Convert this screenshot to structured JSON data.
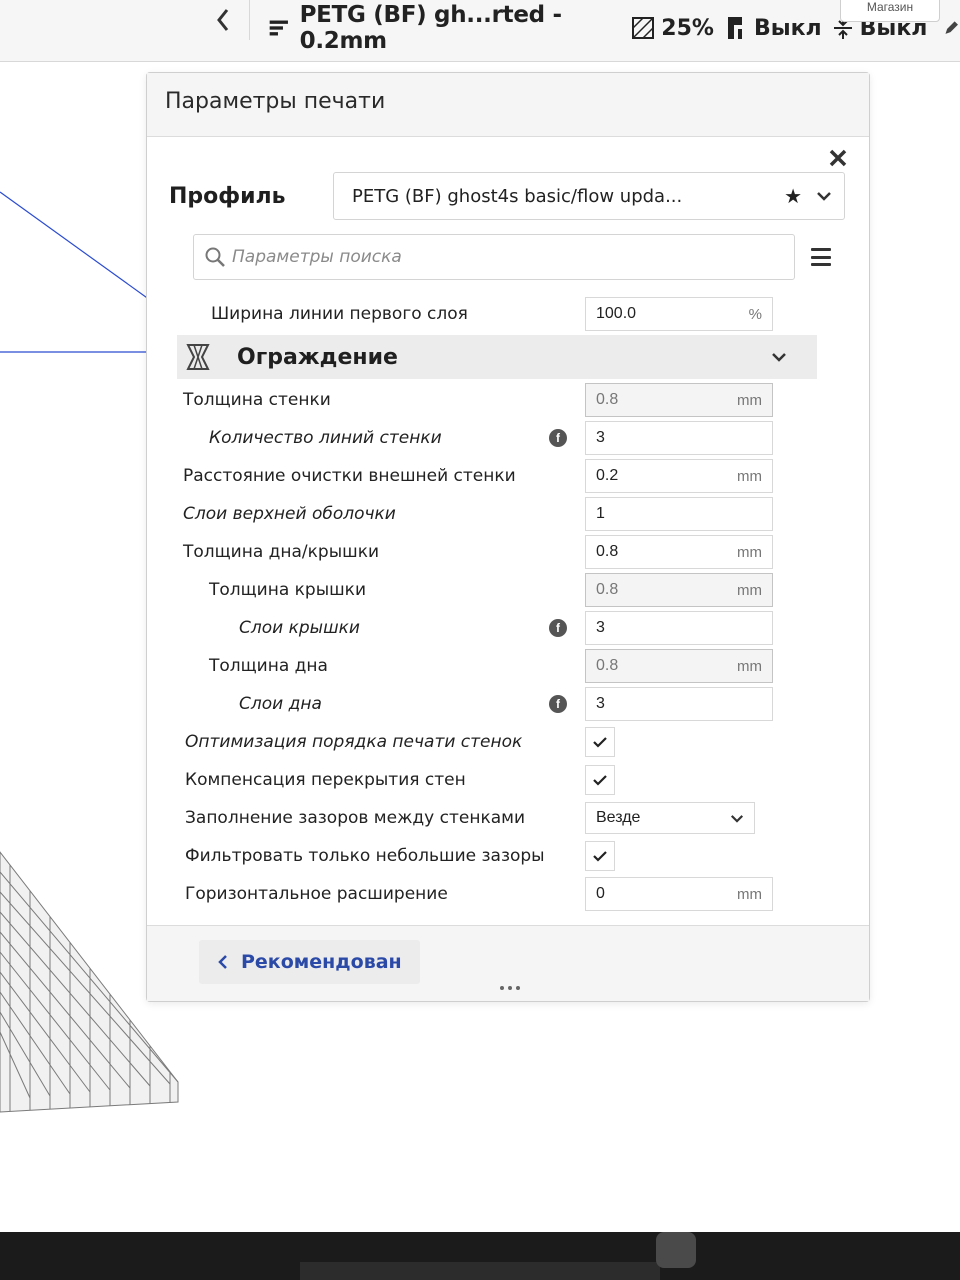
{
  "topbar": {
    "profile_summary": "PETG (BF) gh...rted - 0.2mm",
    "infill": "25%",
    "support": "Выкл",
    "adhesion": "Выкл",
    "shop_label": "Магазин"
  },
  "panel": {
    "title": "Параметры печати",
    "profile_label": "Профиль",
    "profile_value": "PETG (BF) ghost4s basic/flow upda...",
    "search_placeholder": "Параметры поиска",
    "footer_button": "Рекомендован"
  },
  "settings": {
    "first_layer_width": {
      "label": "Ширина линии первого слоя",
      "value": "100.0",
      "unit": "%"
    },
    "section": {
      "title": "Ограждение"
    },
    "wall_thickness": {
      "label": "Толщина стенки",
      "value": "0.8",
      "unit": "mm"
    },
    "wall_line_count": {
      "label": "Количество линий стенки",
      "value": "3"
    },
    "outer_wall_wipe": {
      "label": "Расстояние очистки внешней стенки",
      "value": "0.2",
      "unit": "mm"
    },
    "top_surface_layers": {
      "label": "Слои верхней оболочки",
      "value": "1"
    },
    "top_bottom_thickness": {
      "label": "Толщина дна/крышки",
      "value": "0.8",
      "unit": "mm"
    },
    "top_thickness": {
      "label": "Толщина крышки",
      "value": "0.8",
      "unit": "mm"
    },
    "top_layers": {
      "label": "Слои крышки",
      "value": "3"
    },
    "bottom_thickness": {
      "label": "Толщина дна",
      "value": "0.8",
      "unit": "mm"
    },
    "bottom_layers": {
      "label": "Слои дна",
      "value": "3"
    },
    "optimize_wall_order": {
      "label": "Оптимизация порядка печати стенок",
      "checked": true
    },
    "wall_overlap_comp": {
      "label": "Компенсация перекрытия стен",
      "checked": true
    },
    "fill_gaps": {
      "label": "Заполнение зазоров между стенками",
      "value": "Везде"
    },
    "filter_small_gaps": {
      "label": "Фильтровать только небольшие зазоры",
      "checked": true
    },
    "horizontal_expansion": {
      "label": "Горизонтальное расширение",
      "value": "0",
      "unit": "mm"
    }
  },
  "colors": {
    "accent_link": "#2b4aa8",
    "scrollbar": "#1a1a3a",
    "section_bg": "#ececec"
  }
}
